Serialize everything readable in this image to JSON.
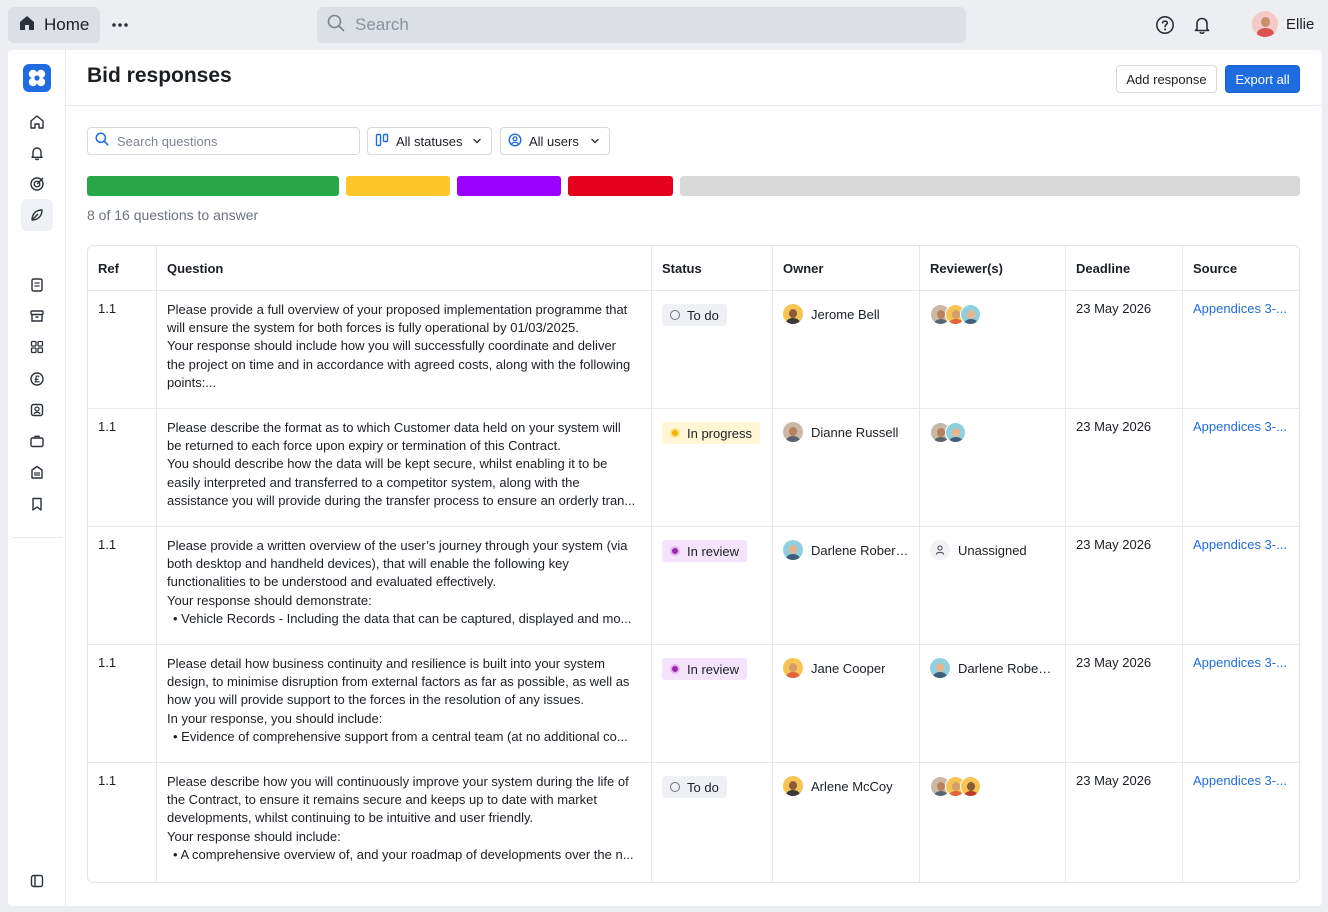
{
  "topbar": {
    "home_label": "Home",
    "search_placeholder": "Search",
    "user_name": "Ellie"
  },
  "page": {
    "title": "Bid responses",
    "add_label": "Add response",
    "export_label": "Export all"
  },
  "filters": {
    "search_placeholder": "Search questions",
    "status_label": "All statuses",
    "users_label": "All users"
  },
  "progress": {
    "label": "8 of 16 questions to answer",
    "answered": 8,
    "total": 16,
    "segment_colors": [
      "#27a745",
      "#ffc629",
      "#9b00ff",
      "#e5001c",
      "#d9d9d9"
    ]
  },
  "table": {
    "headers": [
      "Ref",
      "Question",
      "Status",
      "Owner",
      "Reviewer(s)",
      "Deadline",
      "Source"
    ],
    "rows": [
      {
        "ref": "1.1",
        "lines": [
          "Please provide a full overview of your proposed implementation programme that",
          "will ensure the system for both forces is fully operational by 01/03/2025.",
          "Your response should include how you will successfully coordinate and deliver",
          "the project on time and in accordance with agreed costs, along with the following",
          "points:..."
        ],
        "bullet": "",
        "status": "To do",
        "owner": "Jerome Bell",
        "reviewer": "",
        "deadline": "23 May 2026",
        "source": "Appendices 3-..."
      },
      {
        "ref": "1.1",
        "lines": [
          "Please describe the format as to which Customer data held on your system will",
          "be returned to each force upon expiry or termination of this Contract.",
          "You should describe how the data will be kept secure, whilst enabling it to be",
          "easily interpreted and transferred to a competitor system, along with the",
          "assistance you will provide during the transfer process to ensure an orderly tran..."
        ],
        "bullet": "",
        "status": "In progress",
        "owner": "Dianne Russell",
        "reviewer": "",
        "deadline": "23 May 2026",
        "source": "Appendices 3-..."
      },
      {
        "ref": "1.1",
        "lines": [
          "Please provide a written overview of the user’s journey through your system (via",
          "both desktop and handheld devices), that will enable the following key",
          "functionalities to be understood and evaluated effectively.",
          "Your response should demonstrate:"
        ],
        "bullet": "Vehicle Records - Including the data that can be captured, displayed and mo...",
        "status": "In review",
        "owner": "Darlene Robert...",
        "reviewer": "Unassigned",
        "deadline": "23 May 2026",
        "source": "Appendices 3-..."
      },
      {
        "ref": "1.1",
        "lines": [
          "Please detail how business continuity and resilience is built into your system",
          "design, to minimise disruption from external factors as far as possible, as well as",
          "how you will provide support to the forces in the resolution of any issues.",
          "In your response, you should include:"
        ],
        "bullet": "Evidence of comprehensive support from a central team (at no additional co...",
        "status": "In review",
        "owner": "Jane Cooper",
        "reviewer": "Darlene Robert...",
        "deadline": "23 May 2026",
        "source": "Appendices 3-..."
      },
      {
        "ref": "1.1",
        "lines": [
          "Please describe how you will continuously improve your system during the life of",
          "the Contract, to ensure it remains secure and keeps up to date with market",
          "developments, whilst continuing to be intuitive and user friendly.",
          "Your response should include:"
        ],
        "bullet": "A comprehensive overview of, and your roadmap of developments over the n...",
        "status": "To do",
        "owner": "Arlene McCoy",
        "reviewer": "",
        "deadline": "23 May 2026",
        "source": "Appendices 3-..."
      }
    ]
  }
}
